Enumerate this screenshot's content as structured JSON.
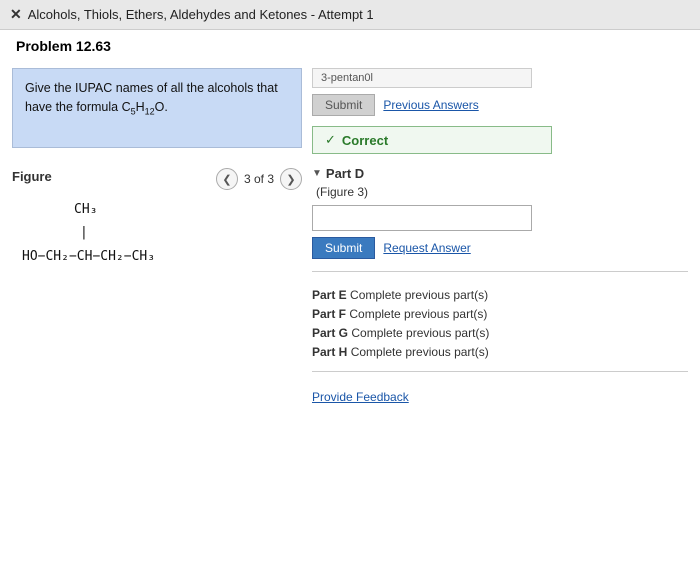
{
  "header": {
    "close_label": "✕",
    "title": "Alcohols, Thiols, Ethers, Aldehydes and Ketones - Attempt 1"
  },
  "problem": {
    "label": "Problem 12.63"
  },
  "question": {
    "text": "Give the IUPAC names of all the alcohols that have the formula C₅H₁₂O."
  },
  "spelling_hint": "3-pentan0l",
  "previous_answers_link": "Previous Answers",
  "correct_label": "Correct",
  "part_d": {
    "label": "Part D",
    "figure_ref": "(Figure 3)",
    "input_placeholder": ""
  },
  "buttons": {
    "submit_disabled": "Submit",
    "submit_active": "Submit",
    "request_answer": "Request Answer"
  },
  "parts": [
    {
      "label": "Part E",
      "status": "Complete previous part(s)"
    },
    {
      "label": "Part F",
      "status": "Complete previous part(s)"
    },
    {
      "label": "Part G",
      "status": "Complete previous part(s)"
    },
    {
      "label": "Part H",
      "status": "Complete previous part(s)"
    }
  ],
  "provide_feedback": "Provide Feedback",
  "figure": {
    "label": "Figure",
    "nav_text": "3 of 3",
    "molecule_line1": "CH₃",
    "molecule_line2": "|",
    "molecule_line3": "HO−CH₂−CH−CH₂−CH₃"
  },
  "side_tabs": [
    "",
    "",
    "",
    ""
  ]
}
